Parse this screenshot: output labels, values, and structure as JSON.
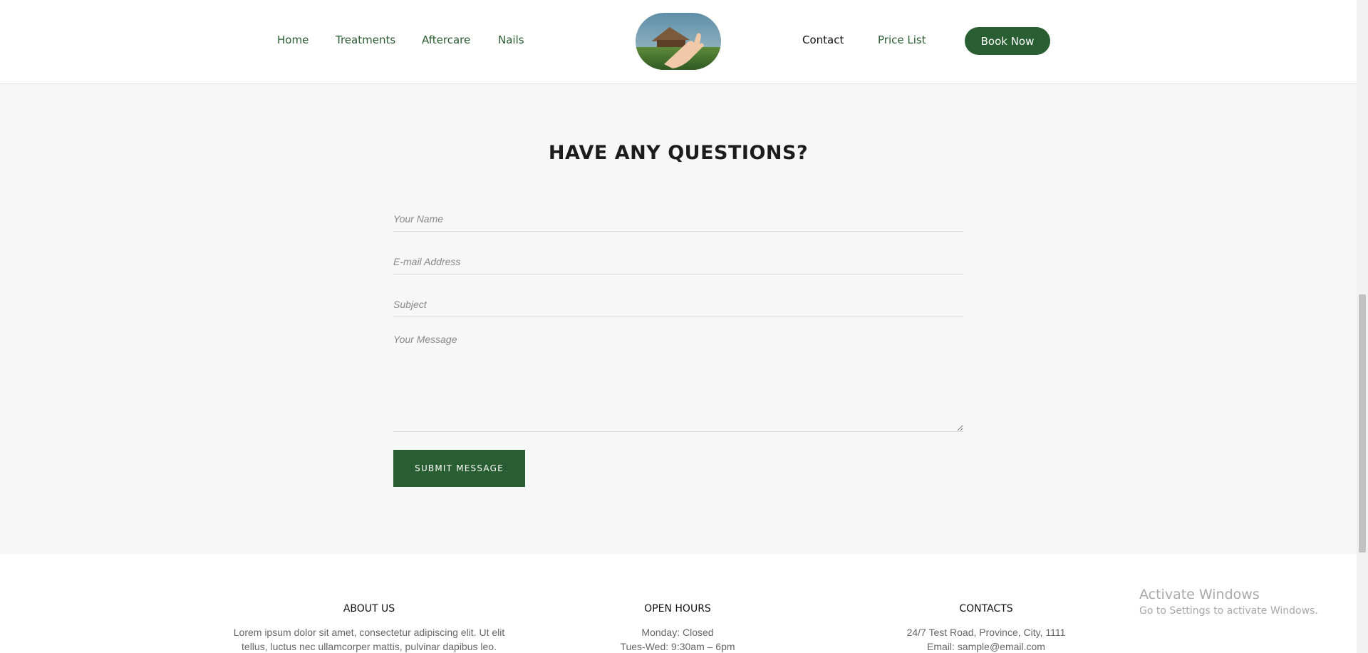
{
  "header": {
    "nav_left": [
      {
        "label": "Home"
      },
      {
        "label": "Treatments"
      },
      {
        "label": "Aftercare"
      },
      {
        "label": "Nails"
      }
    ],
    "nav_right": [
      {
        "label": "Contact",
        "active": true
      },
      {
        "label": "Price List"
      }
    ],
    "book_button": "Book Now",
    "brand_color": "#285e32"
  },
  "contact": {
    "title": "HAVE ANY QUESTIONS?",
    "name_placeholder": "Your Name",
    "email_placeholder": "E-mail Address",
    "subject_placeholder": "Subject",
    "message_placeholder": "Your Message",
    "submit_label": "SUBMIT MESSAGE"
  },
  "footer": {
    "about": {
      "title": "ABOUT US",
      "lines": [
        "Lorem ipsum dolor sit amet, consectetur adipiscing elit. Ut elit",
        "tellus, luctus nec ullamcorper mattis, pulvinar dapibus leo."
      ]
    },
    "hours": {
      "title": "OPEN HOURS",
      "lines": [
        "Monday: Closed",
        "Tues-Wed: 9:30am – 6pm"
      ]
    },
    "contacts": {
      "title": "CONTACTS",
      "lines": [
        "24/7 Test Road, Province, City, 1111",
        "Email: sample@email.com"
      ]
    }
  },
  "watermark": {
    "title": "Activate Windows",
    "subtitle": "Go to Settings to activate Windows."
  }
}
